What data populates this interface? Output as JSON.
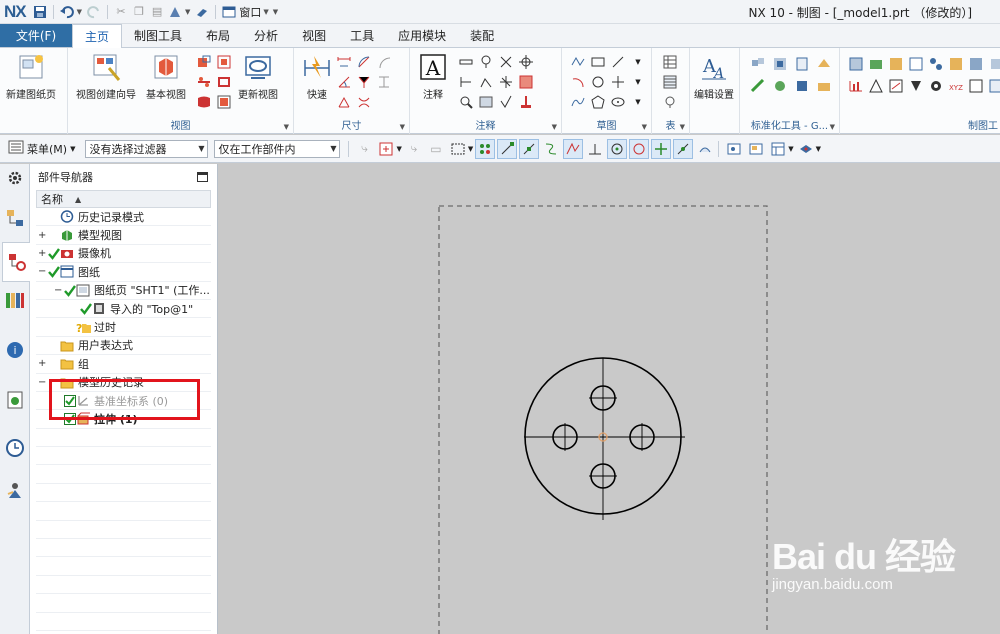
{
  "app": {
    "logo": "NX",
    "window_title": "NX 10 - 制图 - [_model1.prt （修改的）]",
    "quick_access": {
      "window_menu": "窗口"
    }
  },
  "ribbon": {
    "file_tab": "文件(F)",
    "tabs": [
      "主页",
      "制图工具",
      "布局",
      "分析",
      "视图",
      "工具",
      "应用模块",
      "装配"
    ],
    "active_tab": "主页",
    "buttons": {
      "new_sheet": "新建图纸页",
      "view_wizard": "视图创建向导",
      "base_view": "基本视图",
      "update_view": "更新视图",
      "rapid": "快速",
      "note": "注释",
      "edit_settings": "编辑设置"
    },
    "groups": {
      "view": "视图",
      "dimension": "尺寸",
      "annotation": "注释",
      "sketch": "草图",
      "table": "表",
      "std_tools": "标准化工具 - G...",
      "drafting_tools": "制图工"
    }
  },
  "selection_bar": {
    "menu_label": "菜单(M)",
    "filter_value": "没有选择过滤器",
    "scope_value": "仅在工作部件内"
  },
  "navigator": {
    "title": "部件导航器",
    "column_name": "名称",
    "tree": [
      {
        "label": "历史记录模式",
        "level": 0,
        "expander": "",
        "check": false,
        "icon": "clock-icon",
        "style": "normal"
      },
      {
        "label": "模型视图",
        "level": 0,
        "expander": "+",
        "check": false,
        "icon": "model-views-icon",
        "style": "normal"
      },
      {
        "label": "摄像机",
        "level": 0,
        "expander": "+",
        "check": true,
        "icon": "camera-icon",
        "style": "normal"
      },
      {
        "label": "图纸",
        "level": 0,
        "expander": "−",
        "check": true,
        "icon": "drawing-icon",
        "style": "normal"
      },
      {
        "label": "图纸页 \"SHT1\" (工作...",
        "level": 1,
        "expander": "−",
        "check": true,
        "icon": "sheet-icon",
        "style": "normal"
      },
      {
        "label": "导入的 \"Top@1\"",
        "level": 2,
        "expander": "",
        "check": true,
        "icon": "imported-view-icon",
        "style": "normal"
      },
      {
        "label": "过时",
        "level": 1,
        "expander": "",
        "check": false,
        "icon": "outdated-folder-icon",
        "style": "normal"
      },
      {
        "label": "用户表达式",
        "level": 0,
        "expander": "",
        "check": false,
        "icon": "folder-icon",
        "style": "normal"
      },
      {
        "label": "组",
        "level": 0,
        "expander": "+",
        "check": false,
        "icon": "folder-icon",
        "style": "normal"
      },
      {
        "label": "模型历史记录",
        "level": 0,
        "expander": "−",
        "check": false,
        "icon": "folder-icon",
        "style": "normal"
      },
      {
        "label": "基准坐标系 (0)",
        "level": 1,
        "expander": "",
        "check": true,
        "icon": "datum-csys-icon",
        "style": "gray"
      },
      {
        "label": "拉伸 (1)",
        "level": 1,
        "expander": "",
        "check": true,
        "icon": "extrude-icon",
        "style": "bold"
      }
    ]
  },
  "watermark": {
    "brand": "Bai du 经验",
    "url": "jingyan.baidu.com"
  }
}
